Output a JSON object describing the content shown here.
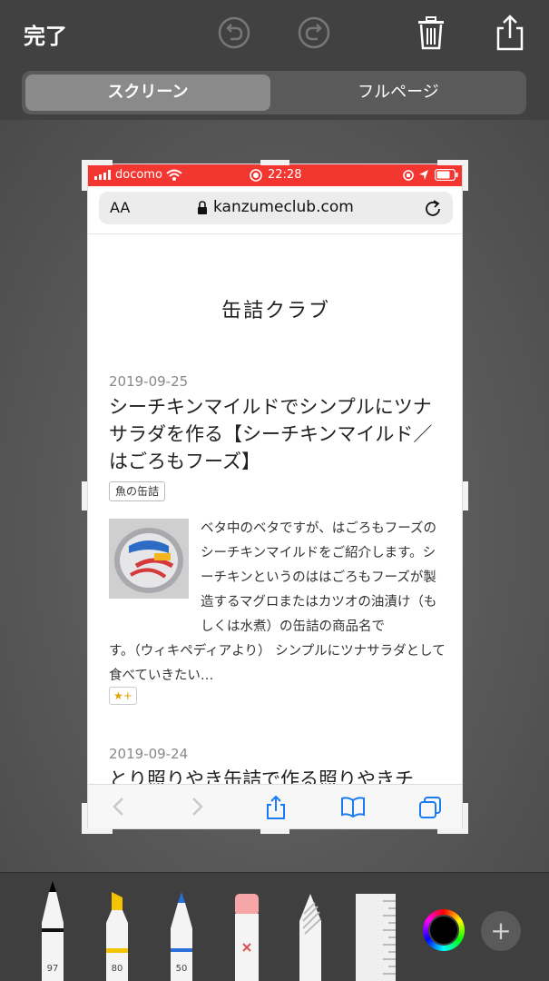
{
  "toolbar": {
    "done_label": "完了",
    "undo_icon": "undo-icon",
    "redo_icon": "redo-icon",
    "trash_icon": "trash-icon",
    "share_icon": "share-icon"
  },
  "segment": {
    "screen_label": "スクリーン",
    "fullpage_label": "フルページ",
    "selected": "スクリーン"
  },
  "screenshot": {
    "status": {
      "carrier": "docomo",
      "time": "22:28",
      "bar_color": "#f3362f"
    },
    "address": {
      "aa": "AA",
      "domain": "kanzumeclub.com"
    },
    "site_title": "缶詰クラブ",
    "posts": [
      {
        "date": "2019-09-25",
        "title": "シーチキンマイルドでシンプルにツナサラダを作る【シーチキンマイルド／はごろもフーズ】",
        "tag": "魚の缶詰",
        "excerpt_side": "ベタ中のベタですが、はごろもフーズのシーチキンマイルドをご紹介します。シーチキンというのははごろもフーズが製造するマグロまたはカツオの油漬け（もしくは水煮）の缶詰の商品名です。（ウィキペディアより） シンプルにツナサラダとして食べていきたい…",
        "excerpt_part1": "ベタ中のベタですが、はごろもフーズのシーチキンマイルドをご紹介します。シーチキンというのははごろもフーズが製造するマグロまたはカツオの油漬け（もしくは水煮）の缶詰の商品名で",
        "excerpt_part2": "す。（ウィキペディアより） シンプルにツナサラダとして食べていきたい…",
        "star_label": "★+"
      },
      {
        "date": "2019-09-24",
        "title": "とり照りやき缶詰で作る照りやきチ"
      }
    ]
  },
  "tools": [
    {
      "name": "pen",
      "number": "97"
    },
    {
      "name": "marker",
      "number": "80"
    },
    {
      "name": "pencil",
      "number": "50"
    },
    {
      "name": "eraser"
    },
    {
      "name": "lasso"
    },
    {
      "name": "ruler"
    }
  ],
  "color_picker": {
    "current": "#000000"
  },
  "plus_label": "+"
}
